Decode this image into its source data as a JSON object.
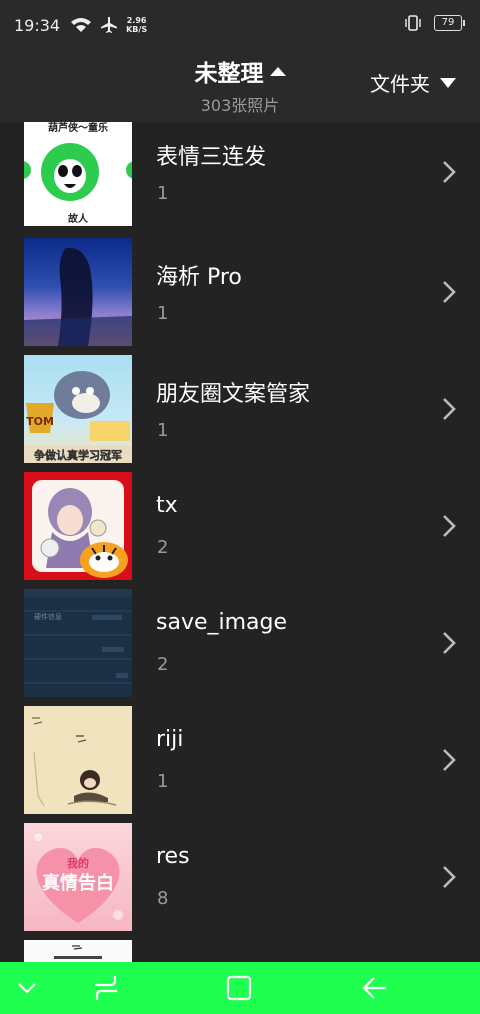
{
  "status_bar": {
    "time": "19:34",
    "net_speed_value": "2.96",
    "net_speed_unit": "KB/S",
    "battery": "79"
  },
  "header": {
    "title": "未整理",
    "subtitle": "303张照片",
    "folder_button": "文件夹"
  },
  "albums": [
    {
      "name": "表情三连发",
      "count": "1",
      "thumb_caption_top": "葫芦侠～童乐",
      "thumb_caption_bottom": "故人"
    },
    {
      "name": "海析 Pro",
      "count": "1"
    },
    {
      "name": "朋友圈文案管家",
      "count": "1",
      "thumb_caption_bottom": "争做认真学习冠军",
      "thumb_badge": "TOM"
    },
    {
      "name": "tx",
      "count": "2"
    },
    {
      "name": "save_image",
      "count": "2",
      "thumb_caption_top": "硬件信息"
    },
    {
      "name": "riji",
      "count": "1"
    },
    {
      "name": "res",
      "count": "8",
      "thumb_caption_top": "我的",
      "thumb_caption_bottom": "真情告白"
    }
  ],
  "colors": {
    "background": "#232323",
    "header": "#2a2a2a",
    "nav_bar": "#1fff4f",
    "muted_text": "#9a9a9a"
  },
  "icons": [
    "wifi-icon",
    "airplane-icon",
    "vibrate-icon",
    "battery-icon",
    "caret-up-icon",
    "caret-down-icon",
    "chevron-right-icon",
    "nav-hide-icon",
    "nav-recents-icon",
    "nav-home-icon",
    "nav-back-icon"
  ]
}
